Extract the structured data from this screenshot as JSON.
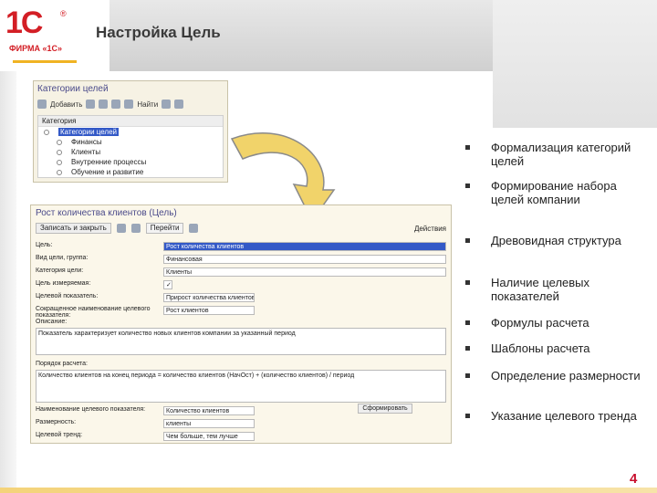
{
  "header": {
    "title": "Настройка Цель",
    "logo_mark": "1С",
    "logo_sub": "ФИРМА «1С»"
  },
  "window_categories": {
    "title": "Категории целей",
    "toolbar": {
      "add_label": "Добавить",
      "search_label": "Найти"
    },
    "column_header": "Категория",
    "items": [
      {
        "label": "Категории целей",
        "selected": true
      },
      {
        "label": "Финансы",
        "selected": false
      },
      {
        "label": "Клиенты",
        "selected": false
      },
      {
        "label": "Внутренние процессы",
        "selected": false
      },
      {
        "label": "Обучение и развитие",
        "selected": false
      }
    ]
  },
  "window_goal": {
    "title": "Рост количества клиентов (Цель)",
    "toolbar": {
      "save_close_label": "Записать и закрыть",
      "dropdown_label": "Перейти",
      "right_label": "Действия"
    },
    "fields": [
      {
        "label": "Цель:",
        "value": "Рост количества клиентов",
        "highlight": true
      },
      {
        "label": "Вид цели, группа:",
        "value": "Финансовая",
        "highlight": false
      },
      {
        "label": "Категория цели:",
        "value": "Клиенты",
        "highlight": false
      },
      {
        "label": "Цель измеряемая:",
        "value": "✓",
        "highlight": false
      },
      {
        "label": "Целевой показатель:",
        "value": "Прирост количества клиентов",
        "highlight": false
      },
      {
        "label": "Сокращенное наименование целевого показателя:",
        "value": "Рост клиентов",
        "highlight": false
      }
    ],
    "description_label": "Описание:",
    "description_text": "Показатель характеризует количество новых клиентов компании за указанный период",
    "formula_label": "Порядок расчета:",
    "formula_text": "Количество клиентов на конец периода = количество клиентов (НачОст) + (количество клиентов) / период",
    "fields_bottom": [
      {
        "label": "Наименование целевого показателя:",
        "value": "Количество клиентов"
      },
      {
        "label": "Размерность:",
        "value": "клиенты"
      },
      {
        "label": "Целевой тренд:",
        "value": "Чем больше, тем лучше"
      }
    ],
    "calc_button_label": "Сформировать"
  },
  "bullets": [
    "Формализация категорий целей",
    "Формирование набора целей компании",
    "Древовидная структура",
    "Наличие целевых показателей",
    "Формулы расчета",
    "Шаблоны расчета",
    "Определение размерности",
    "Указание целевого тренда"
  ],
  "page_number": "4",
  "colors": {
    "brand_red": "#d31e25",
    "selection_blue": "#3359c7",
    "arrow_yellow": "#f1d36a"
  }
}
